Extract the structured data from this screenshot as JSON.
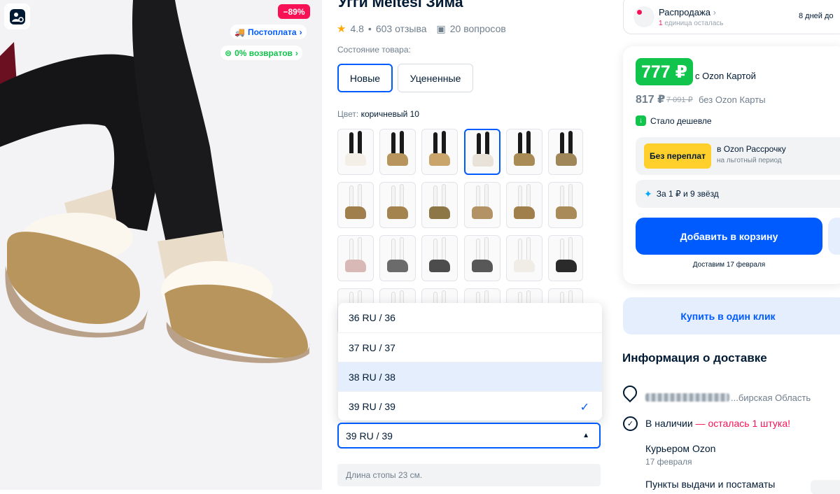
{
  "gallery": {
    "discount_badge": "−89%",
    "postpay_label": "Постоплата",
    "returns_label": "0% возвратов"
  },
  "product": {
    "title": "Угги Meltesi Зима",
    "rating": "4.8",
    "reviews": "603 отзыва",
    "questions": "20 вопросов",
    "condition_label": "Состояние товара:",
    "condition_new": "Новые",
    "condition_discounted": "Уцененные",
    "color_label": "Цвет:",
    "color_value": "коричневый 10"
  },
  "sizes": {
    "options": [
      "36 RU / 36",
      "37 RU / 37",
      "38 RU / 38",
      "39 RU / 39"
    ],
    "highlighted": "38 RU / 38",
    "selected": "39 RU / 39",
    "foot_length": "Длина стопы 23 см."
  },
  "sale": {
    "title": "Распродажа",
    "count": "1",
    "subtitle": " единица осталась",
    "days_left": "8 дней до"
  },
  "price": {
    "ozon_card_price": "777 ₽",
    "ozon_card_note": "с Ozon Картой",
    "regular_price": "817 ₽",
    "old_price": "7 091 ₽",
    "regular_note": "без Ozon Карты",
    "cheaper_note": "Стало дешевле",
    "no_overpay": "Без переплат",
    "installment_title": "в Ozon Рассрочку",
    "installment_sub": "на льготный период",
    "stars_offer": "За 1 ₽ и 9 звёзд",
    "add_to_cart": "Добавить в корзину",
    "delivery_date": "Доставим 17 февраля"
  },
  "buy_one_click": "Купить в один клик",
  "delivery": {
    "heading": "Информация о доставке",
    "location": "...бирская Область",
    "in_stock": "В наличии",
    "stock_warning": " — осталась 1 штука!",
    "courier_title": "Курьером Ozon",
    "courier_date": "17 февраля",
    "pickup_title": "Пункты выдачи и постаматы"
  },
  "colors": {
    "accent": "#005bff",
    "green": "#10c44c",
    "pink": "#f91155",
    "yellow": "#ffd02b"
  }
}
